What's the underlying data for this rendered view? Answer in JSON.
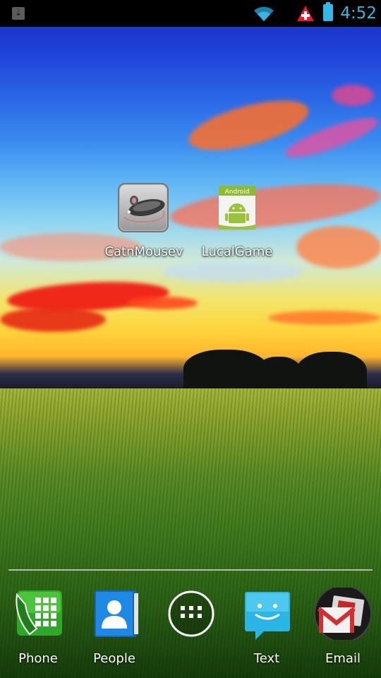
{
  "status_bar": {
    "time": "4:52",
    "accent_color": "#33b5e5",
    "icons": [
      "download-notification-icon",
      "wifi-icon",
      "alert-icon",
      "battery-icon"
    ]
  },
  "desktop": {
    "apps": [
      {
        "label": "CatnMousev",
        "icon": "mouse-icon"
      },
      {
        "label": "LucalGame",
        "icon": "android-app-icon",
        "badge_text": "Android"
      }
    ]
  },
  "dock": {
    "items": [
      {
        "label": "Phone",
        "icon": "phone-icon"
      },
      {
        "label": "People",
        "icon": "people-icon"
      },
      {
        "label": "",
        "icon": "app-drawer-icon"
      },
      {
        "label": "Text",
        "icon": "messaging-icon"
      },
      {
        "label": "Email",
        "icon": "gmail-icon"
      }
    ]
  }
}
